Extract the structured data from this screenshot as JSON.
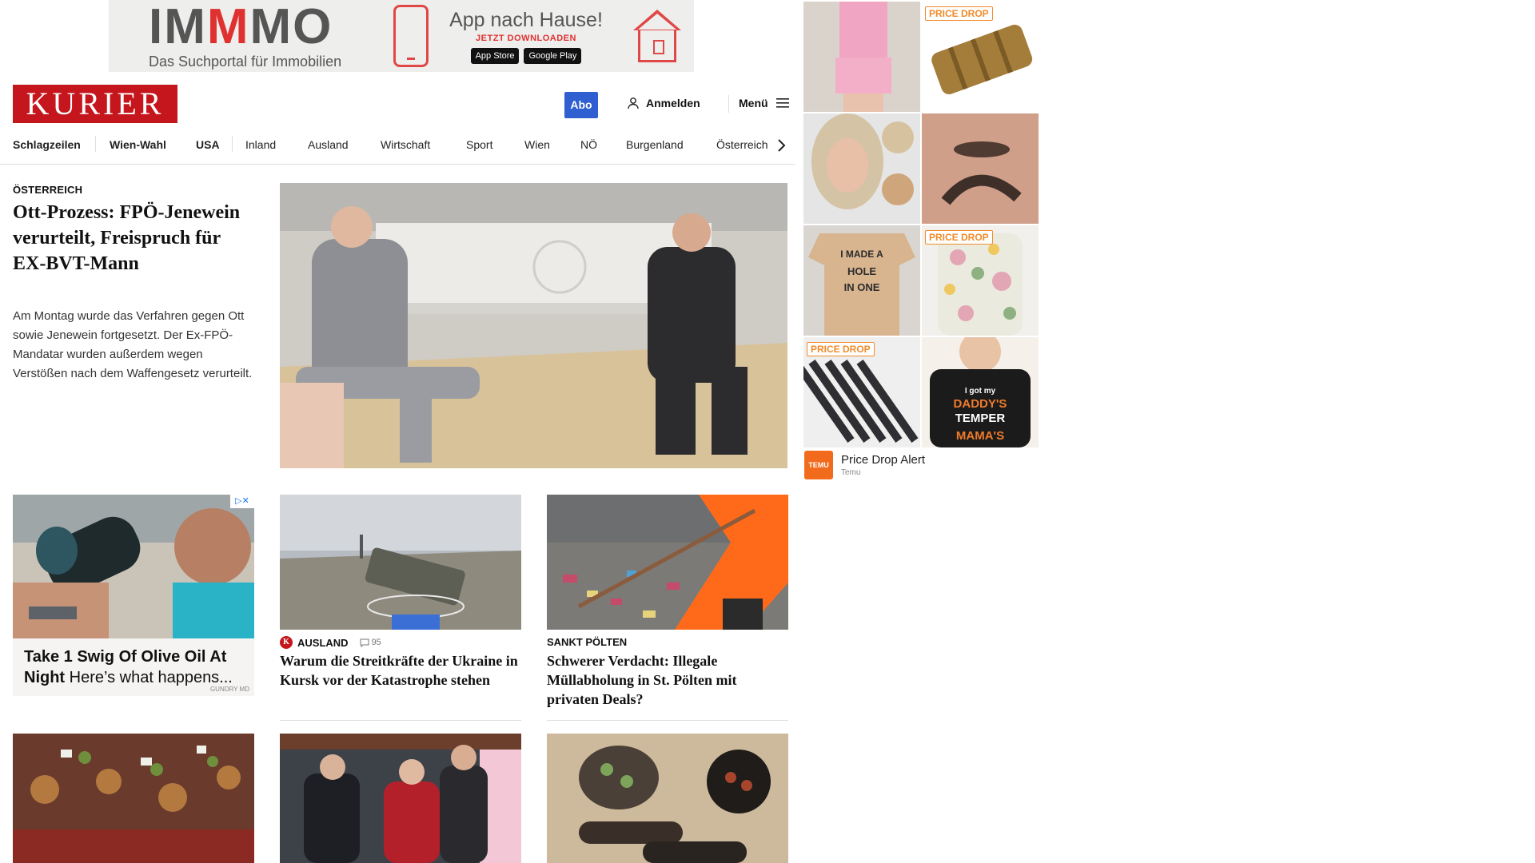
{
  "banner": {
    "logo_pre": "IM",
    "logo_red": "M",
    "logo_post": "MO",
    "tagline": "Das Suchportal für Immobilien",
    "app_title": "App nach Hause!",
    "app_sub": "JETZT DOWNLOADEN",
    "store_apple": "App Store",
    "store_google": "Google Play"
  },
  "header": {
    "brand": "KURIER",
    "abo_label": "Abo",
    "login_label": "Anmelden",
    "menu_label": "Menü"
  },
  "nav": {
    "items": [
      "Schlagzeilen",
      "Wien-Wahl",
      "USA",
      "Inland",
      "Ausland",
      "Wirtschaft",
      "Sport",
      "Wien",
      "NÖ",
      "Burgenland",
      "Österreich"
    ]
  },
  "lead": {
    "kicker": "ÖSTERREICH",
    "title": "Ott-Prozess: FPÖ-Jenewein verurteilt, Freispruch für EX-BVT-Mann",
    "text": "Am Montag wurde das Verfahren gegen Ott sowie Jenewein fortgesetzt. Der Ex-FPÖ-Mandatar wurden außerdem wegen Verstößen nach dem Waffengesetz verurteilt."
  },
  "ad_card": {
    "title_bold": "Take 1 Swig Of Olive Oil At Night",
    "title_rest": "Here’s what happens...",
    "brand": "GUNDRY MD"
  },
  "cards": [
    {
      "kicker": "AUSLAND",
      "badge": "K",
      "comments": "95",
      "title": "Warum die Streitkräfte der Ukraine in Kursk vor der Katastrophe stehen"
    },
    {
      "kicker": "SANKT PÖLTEN",
      "title": "Schwerer Verdacht: Illegale Müllabholung in St. Pölten mit privaten Deals?"
    }
  ],
  "side_ad": {
    "badge": "PRICE DROP",
    "shirt1_text": "I MADE A HOLE IN ONE",
    "shirt2_text": "I got my DADDY'S TEMPER and my MAMA'S",
    "footer_title": "Price Drop Alert",
    "footer_sub": "Temu",
    "logo_text": "TEMU"
  },
  "colors": {
    "brand_red": "#c4161c",
    "abo_blue": "#2f5fd0",
    "temu_orange": "#f26b1d"
  }
}
